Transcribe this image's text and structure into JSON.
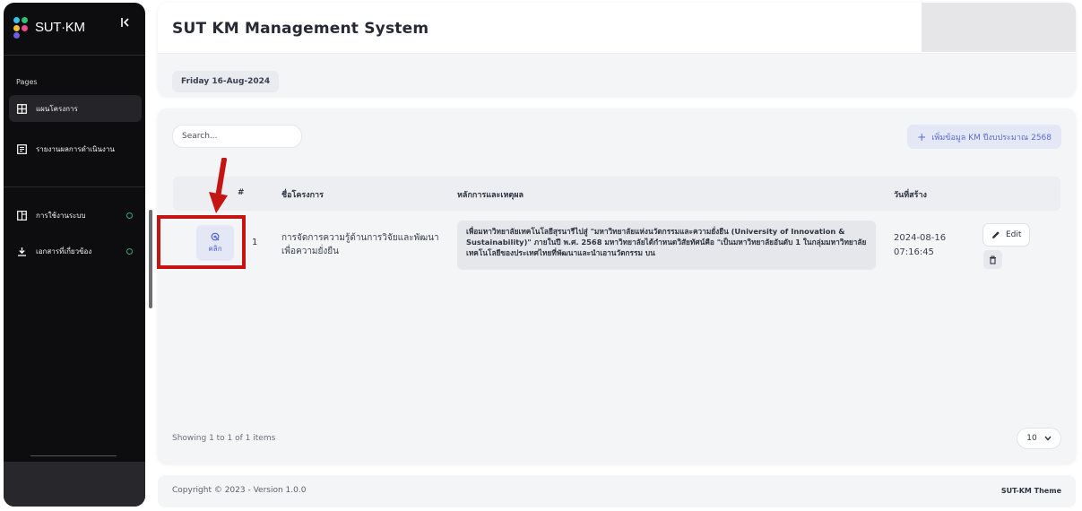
{
  "sidebar": {
    "brand": "SUT·KM",
    "collapse_icon": "chevrons-left-icon",
    "section_label": "Pages",
    "items": [
      {
        "label": "แผนโครงการ",
        "icon": "grid-icon",
        "active": true
      },
      {
        "label": "รายงานผลการดำเนินงาน",
        "icon": "report-icon",
        "active": false
      },
      {
        "label": "การใช้งานระบบ",
        "icon": "layout-icon",
        "active": false,
        "status": "green"
      },
      {
        "label": "เอกสารที่เกี่ยวข้อง",
        "icon": "download-icon",
        "active": false,
        "status": "green"
      }
    ]
  },
  "header": {
    "title": "SUT KM Management System",
    "date": "Friday 16-Aug-2024"
  },
  "toolbar": {
    "search_placeholder": "Search...",
    "add_label": "เพิ่มข้อมูล KM ปีงบประมาณ 2568"
  },
  "table": {
    "columns": [
      "#",
      "ชื่อโครงการ",
      "หลักการและเหตุผล",
      "วันที่สร้าง"
    ],
    "rows": [
      {
        "click_label": "คลิก",
        "num": "1",
        "name": "การจัดการความรู้ด้านการวิจัยและพัฒนาเพื่อความยั่งยืน",
        "reason": "เพื่อมหาวิทยาลัยเทคโนโลยีสุรนารีไปสู่ \"มหาวิทยาลัยแห่งนวัตกรรมและความยั่งยืน (University of Innovation & Sustainability)\" ภายในปี พ.ศ. 2568 มหาวิทยาลัยได้กำหนดวิสัยทัศน์คือ \"เป็นมหาวิทยาลัยอันดับ 1 ในกลุ่มมหาวิทยาลัยเทคโนโลยีของประเทศไทยที่พัฒนาและนำเอานวัตกรรม บน",
        "date": "2024-08-16",
        "time": "07:16:45",
        "edit_label": "Edit"
      }
    ]
  },
  "pagination": {
    "showing": "Showing 1 to 1 of 1 items",
    "page_size": "10"
  },
  "footer": {
    "copyright": "Copyright © 2023 - Version 1.0.0",
    "theme": "SUT-KM Theme"
  },
  "colors": {
    "accent": "#5a6bd0",
    "annotation": "#c41512",
    "status": "#3ba86b"
  }
}
